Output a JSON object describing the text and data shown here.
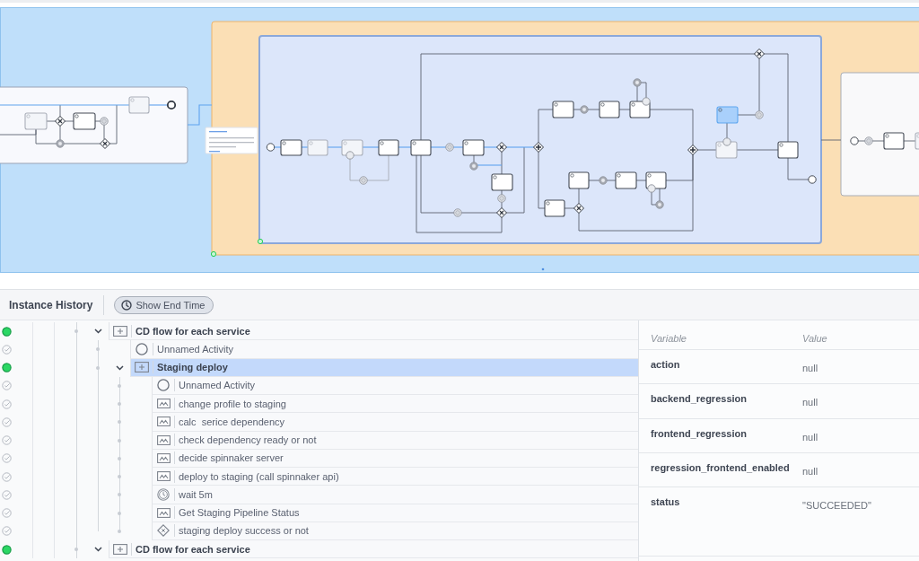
{
  "history": {
    "title": "Instance History",
    "end_time_button": "Show End Time"
  },
  "rows": [
    {
      "label": "CD flow for each service",
      "kind": "subprocess",
      "completed": false,
      "expanded": true,
      "selected": false,
      "children": [
        {
          "label": "Unnamed Activity",
          "kind": "start_event",
          "completed": true,
          "selected": false
        },
        {
          "label": "Staging deploy",
          "kind": "subprocess",
          "completed": false,
          "expanded": true,
          "selected": true,
          "children": [
            {
              "label": "Unnamed Activity",
              "kind": "start_event",
              "completed": true,
              "selected": false
            },
            {
              "label": "change profile to staging",
              "kind": "task",
              "completed": true,
              "selected": false
            },
            {
              "label": "calc  serice dependency",
              "kind": "task",
              "completed": true,
              "selected": false
            },
            {
              "label": "check dependency ready or not",
              "kind": "task",
              "completed": true,
              "selected": false
            },
            {
              "label": "decide spinnaker server",
              "kind": "task",
              "completed": true,
              "selected": false
            },
            {
              "label": "deploy to staging (call spinnaker api)",
              "kind": "task",
              "completed": true,
              "selected": false
            },
            {
              "label": "wait 5m",
              "kind": "timer",
              "completed": true,
              "selected": false
            },
            {
              "label": "Get Staging Pipeline Status",
              "kind": "task",
              "completed": true,
              "selected": false
            },
            {
              "label": "staging deploy success or not",
              "kind": "gateway",
              "completed": true,
              "selected": false
            }
          ]
        }
      ]
    },
    {
      "label": "CD flow for each service",
      "kind": "subprocess",
      "completed": false,
      "expanded": true,
      "selected": false
    }
  ],
  "variables": {
    "columns": [
      "Variable",
      "Value"
    ],
    "rows": [
      {
        "name": "action",
        "value": "null"
      },
      {
        "name": "backend_regression",
        "value": "null"
      },
      {
        "name": "frontend_regression",
        "value": "null"
      },
      {
        "name": "regression_frontend_enabled",
        "value": "null"
      },
      {
        "name": "status",
        "value": "\"SUCCEEDED\""
      }
    ]
  }
}
